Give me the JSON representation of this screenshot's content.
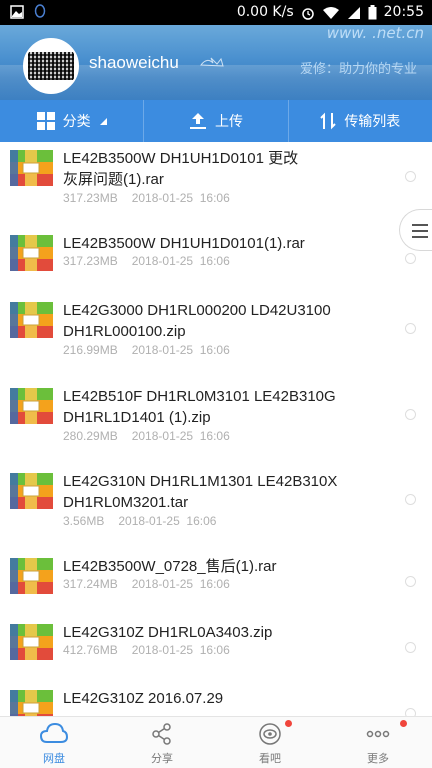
{
  "status_bar": {
    "speed": "0.00 K/s",
    "time": "20:55"
  },
  "header": {
    "username": "shaoweichu",
    "watermark_line1": "www.     .net.cn",
    "watermark_line2": "爱修：助力你的专业"
  },
  "toolbar": [
    {
      "label": "分类",
      "icon": "grid-icon"
    },
    {
      "label": "上传",
      "icon": "upload-icon"
    },
    {
      "label": "传输列表",
      "icon": "transfer-icon"
    }
  ],
  "files": [
    {
      "name": "LE42B3500W DH1UH1D0101 更改\n灰屏问题(1).rar",
      "size": "317.23MB",
      "date": "2018-01-25  16:06"
    },
    {
      "name": "LE42B3500W DH1UH1D0101(1).rar",
      "size": "317.23MB",
      "date": "2018-01-25  16:06"
    },
    {
      "name": "LE42G3000 DH1RL000200 LD42U3100\nDH1RL000100.zip",
      "size": "216.99MB",
      "date": "2018-01-25  16:06"
    },
    {
      "name": "LE42B510F DH1RL0M3101 LE42B310G\nDH1RL1D1401 (1).zip",
      "size": "280.29MB",
      "date": "2018-01-25  16:06"
    },
    {
      "name": "LE42G310N DH1RL1M1301 LE42B310X\nDH1RL0M3201.tar",
      "size": "3.56MB",
      "date": "2018-01-25  16:06"
    },
    {
      "name": "LE42B3500W_0728_售后(1).rar",
      "size": "317.24MB",
      "date": "2018-01-25  16:06"
    },
    {
      "name": "LE42G310Z DH1RL0A3403.zip",
      "size": "412.76MB",
      "date": "2018-01-25  16:06"
    },
    {
      "name": "LE42G310Z 2016.07.29",
      "size": "",
      "date": ""
    }
  ],
  "bottom_nav": [
    {
      "label": "网盘",
      "icon": "cloud-icon",
      "active": true
    },
    {
      "label": "分享",
      "icon": "share-icon",
      "active": false
    },
    {
      "label": "看吧",
      "icon": "eye-icon",
      "active": false
    },
    {
      "label": "更多",
      "icon": "more-icon",
      "active": false
    }
  ],
  "colors": {
    "accent": "#3c8ce0",
    "badge": "#f0453b"
  }
}
